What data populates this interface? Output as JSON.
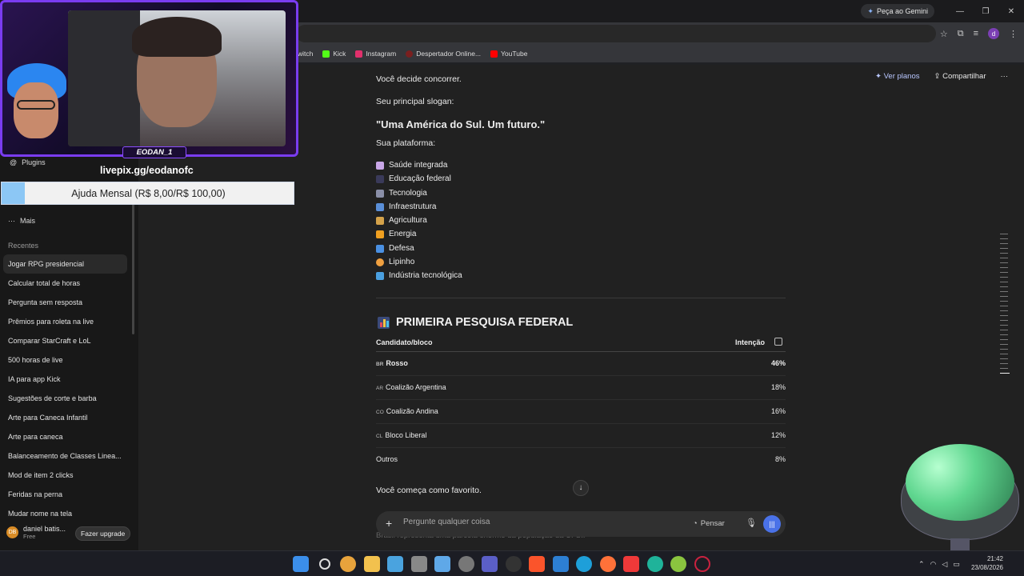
{
  "browser": {
    "gemini_label": "Peça ao Gemini",
    "profile_initial": "d",
    "bookmarks": [
      {
        "label": "witch",
        "color": "#9147ff"
      },
      {
        "label": "Kick",
        "color": "#53fc18"
      },
      {
        "label": "Instagram",
        "color": "#e1306c"
      },
      {
        "label": "Despertador Online...",
        "color": "#7a1f1f"
      },
      {
        "label": "YouTube",
        "color": "#ff0000"
      }
    ]
  },
  "overlay": {
    "streamer_tag": "EODAN_1",
    "livepix": "livepix.gg/eodanofc",
    "donation_goal": "Ajuda Mensal (R$ 8,00/R$ 100,00)",
    "donation_progress": 0.08
  },
  "sidebar": {
    "plugins": "Plugins",
    "mais": "Mais",
    "recentes_label": "Recentes",
    "recent": [
      "Jogar RPG presidencial",
      "Calcular total de horas",
      "Pergunta sem resposta",
      "Prêmios para roleta na live",
      "Comparar StarCraft e LoL",
      "500 horas de live",
      "IA para app Kick",
      "Sugestões de corte e barba",
      "Arte para Caneca Infantil",
      "Arte para caneca",
      "Balanceamento de Classes Linea...",
      "Mod de item 2 clicks",
      "Feridas na perna",
      "Mudar nome na tela"
    ],
    "user_name": "daniel batis...",
    "user_plan": "Free",
    "upgrade": "Fazer upgrade"
  },
  "header": {
    "plans": "Ver planos",
    "share": "Compartilhar"
  },
  "chat": {
    "line1": "Você decide concorrer.",
    "line2": "Seu principal slogan:",
    "slogan": "\"Uma América do Sul. Um futuro.\"",
    "platform_label": "Sua plataforma:",
    "platform": [
      {
        "label": "Saúde integrada",
        "color": "#c9a7e8"
      },
      {
        "label": "Educação federal",
        "color": "#3a3a5a"
      },
      {
        "label": "Tecnologia",
        "color": "#8a8fa8"
      },
      {
        "label": "Infraestrutura",
        "color": "#5a8fd8"
      },
      {
        "label": "Agricultura",
        "color": "#d4a24a"
      },
      {
        "label": "Energia",
        "color": "#f0a020"
      },
      {
        "label": "Defesa",
        "color": "#4a90e2"
      },
      {
        "label": "Lipinho",
        "color": "#f0a040"
      },
      {
        "label": "Indústria tecnológica",
        "color": "#4aa0e0"
      }
    ],
    "section_title": "PRIMEIRA PESQUISA FEDERAL",
    "table": {
      "col1": "Candidato/bloco",
      "col2": "Intenção",
      "rows": [
        {
          "code": "BR",
          "name": "Rosso",
          "value": "46%"
        },
        {
          "code": "AR",
          "name": "Coalizão Argentina",
          "value": "18%"
        },
        {
          "code": "CO",
          "name": "Coalizão Andina",
          "value": "16%"
        },
        {
          "code": "CL",
          "name": "Bloco Liberal",
          "value": "12%"
        },
        {
          "code": "",
          "name": "Outros",
          "value": "8%"
        }
      ]
    },
    "after_table": "Você começa como favorito.",
    "faded": "Brasil representa uma parcela enorme da população da UFSI."
  },
  "composer": {
    "placeholder": "Pergunte qualquer coisa",
    "think": "Pensar"
  },
  "taskbar": {
    "time": "21:42",
    "date": "23/08/2026"
  }
}
